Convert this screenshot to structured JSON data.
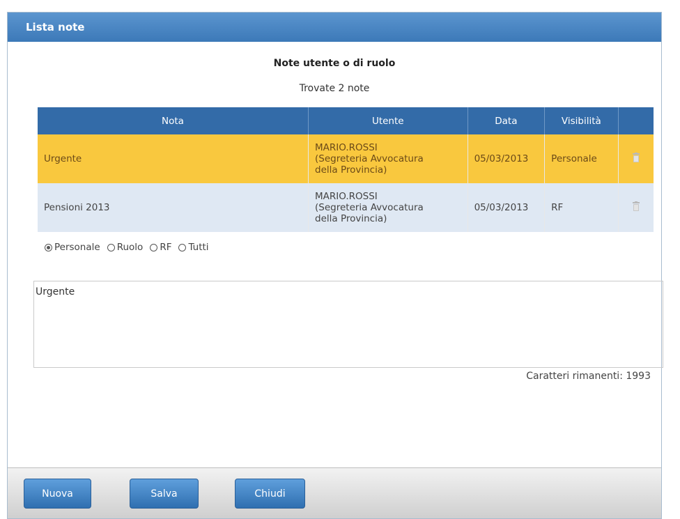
{
  "window": {
    "title": "Lista note"
  },
  "heading": "Note utente o di ruolo",
  "found_text": "Trovate 2 note",
  "table": {
    "columns": [
      "Nota",
      "Utente",
      "Data",
      "Visibilità"
    ],
    "rows": [
      {
        "nota": "Urgente",
        "utente_line1": "MARIO.ROSSI",
        "utente_line2": "(Segreteria Avvocatura",
        "utente_line3": "della Provincia)",
        "data": "05/03/2013",
        "visibilita": "Personale",
        "selected": true
      },
      {
        "nota": "Pensioni 2013",
        "utente_line1": "MARIO.ROSSI",
        "utente_line2": "(Segreteria Avvocatura",
        "utente_line3": "della Provincia)",
        "data": "05/03/2013",
        "visibilita": "RF",
        "selected": false
      }
    ]
  },
  "visibility_options": {
    "selected": "Personale",
    "items": [
      "Personale",
      "Ruolo",
      "RF",
      "Tutti"
    ]
  },
  "note_text": "Urgente",
  "remaining_chars": "Caratteri rimanenti: 1993",
  "buttons": {
    "nuova": "Nuova",
    "salva": "Salva",
    "chiudi": "Chiudi"
  },
  "colors": {
    "header": "#336ba8",
    "selected_row": "#f9c83e",
    "row": "#dfe8f3",
    "title_bar": "#4a88c6"
  },
  "icons": {
    "row_action": "trash-icon"
  }
}
